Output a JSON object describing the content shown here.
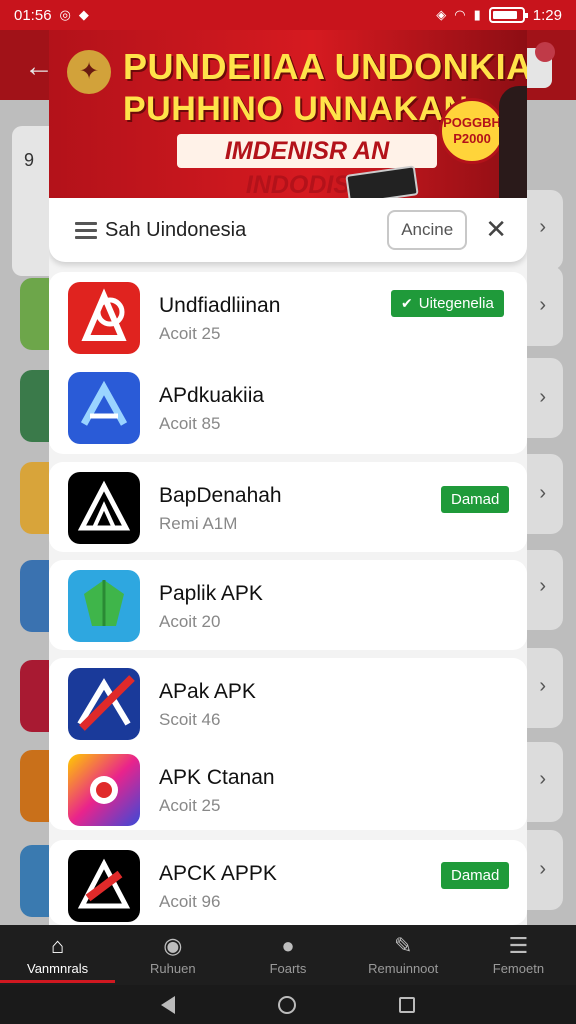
{
  "status_bar": {
    "time_left": "01:56",
    "time_right": "1:29"
  },
  "banner": {
    "line1": "PUNDEIIAA UNDONKIAN",
    "line2": "PUHHINO UNNAKAN",
    "line3": "IMDENISR AN INDODISH",
    "badge": "POGGBH P2000"
  },
  "search_card": {
    "title": "Sah Uindonesia",
    "action_label": "Ancine",
    "close_glyph": "✕"
  },
  "apps": [
    {
      "name": "Undfiadliinan",
      "sub": "Acoit 25",
      "tag": "Uitegenelia",
      "tag_icon": "check-icon",
      "icon_colors": [
        "#e0231f",
        "#c5161a"
      ]
    },
    {
      "name": "APdkuakiia",
      "sub": "Acoit 85",
      "tag": "",
      "icon_colors": [
        "#2a5bd7",
        "#1c3fa8"
      ]
    },
    {
      "name": "BapDenahah",
      "sub": "Remi A1M",
      "tag": "Damad",
      "icon_colors": [
        "#000000",
        "#111111"
      ]
    },
    {
      "name": "Paplik APK",
      "sub": "Acoit 20",
      "tag": "",
      "icon_colors": [
        "#2ea7e0",
        "#1b7fc2"
      ]
    },
    {
      "name": "APak APK",
      "sub": "Scoit 46",
      "tag": "",
      "icon_colors": [
        "#1a3a9a",
        "#e02a2a"
      ]
    },
    {
      "name": "APK Ctanan",
      "sub": "Acoit 25",
      "tag": "",
      "icon_colors": [
        "#ffcc00",
        "#e9238c"
      ]
    },
    {
      "name": "APCK APPK",
      "sub": "Acoit 96",
      "tag": "Damad",
      "icon_colors": [
        "#000000",
        "#111111"
      ]
    }
  ],
  "bottom_nav": [
    {
      "label": "Vanmnrals",
      "icon": "home-icon",
      "active": true
    },
    {
      "label": "Ruhuen",
      "icon": "camera-icon",
      "active": false
    },
    {
      "label": "Foarts",
      "icon": "person-icon",
      "active": false
    },
    {
      "label": "Remuinnoot",
      "icon": "wrench-icon",
      "active": false
    },
    {
      "label": "Femoetn",
      "icon": "stack-icon",
      "active": false
    }
  ],
  "colors": {
    "brand_red": "#c8141c",
    "tag_green": "#1f9a3a",
    "nav_bg": "#1e1e1e"
  }
}
